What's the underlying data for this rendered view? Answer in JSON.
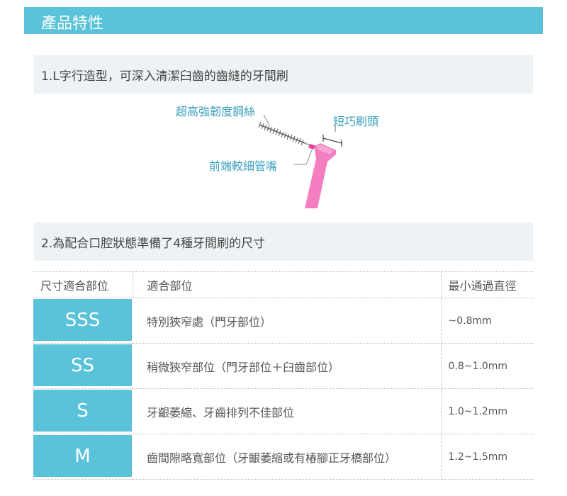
{
  "header": {
    "title": "產品特性"
  },
  "section1": {
    "title": "1.L字行造型，可深入清潔臼齒的齒縫的牙間刷",
    "callouts": {
      "wire": "超高強韌度鋼絲",
      "short_head": "短巧刷頭",
      "tip": "前端較細管嘴"
    }
  },
  "section2": {
    "title": "2.為配合口腔狀態準備了4種牙間刷的尺寸"
  },
  "table": {
    "headers": [
      "尺寸適合部位",
      "適合部位",
      "最小通過直徑"
    ],
    "rows": [
      {
        "size": "SSS",
        "area": "特別狹窄處（門牙部位）",
        "diameter": "~0.8mm"
      },
      {
        "size": "SS",
        "area": "稍微狹窄部位（門牙部位＋臼齒部位）",
        "diameter": "0.8~1.0mm"
      },
      {
        "size": "S",
        "area": "牙齦萎縮、牙齒排列不佳部位",
        "diameter": "1.0~1.2mm"
      },
      {
        "size": "M",
        "area": "齒間隙略寬部位（牙齦萎縮或有椿腳正牙橋部位）",
        "diameter": "1.2~1.5mm"
      }
    ]
  },
  "colors": {
    "accent": "#5ac3d9",
    "brush_pink": "#f47fc0",
    "callout_text": "#3a9fbd"
  }
}
